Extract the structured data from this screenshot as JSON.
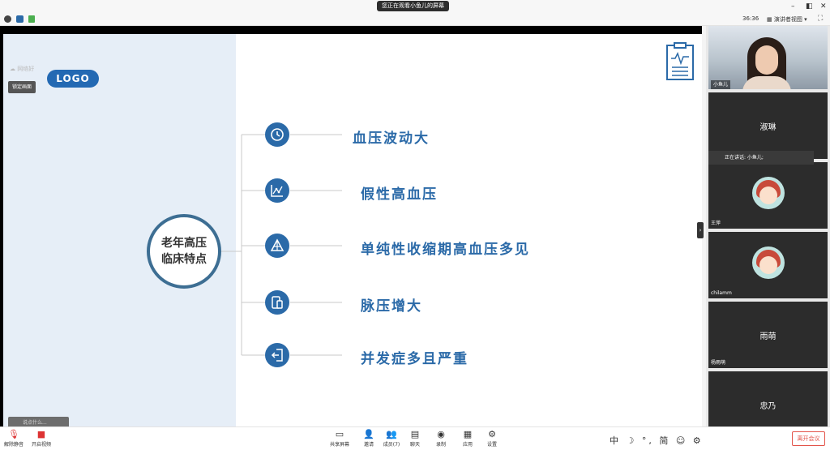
{
  "titlebar": {
    "viewing_label": "您正在观看小鱼儿的屏幕",
    "minimize": "–",
    "restore": "◧",
    "close": "✕"
  },
  "toolbar": {
    "timer": "36:36",
    "view_label": "▦ 演讲者视图 ▾",
    "fullscreen": "⛶"
  },
  "slide": {
    "logo": "LOGO",
    "center_title_line1": "老年高压",
    "center_title_line2": "临床特点",
    "items": [
      {
        "text": "血压波动大",
        "icon": "clock-icon"
      },
      {
        "text": "假性高血压",
        "icon": "chart-icon"
      },
      {
        "text": "单纯性收缩期高血压多见",
        "icon": "triangle-icon"
      },
      {
        "text": "脉压增大",
        "icon": "device-icon"
      },
      {
        "text": "并发症多且严重",
        "icon": "exit-icon"
      }
    ]
  },
  "overlay": {
    "top_hint": "☁ 网络好",
    "pin_label": "锁定画面",
    "chat_placeholder": "说点什么..."
  },
  "participants": {
    "self_name": "小鱼儿",
    "tile2_name": "淑琳",
    "speaking": "正在讲话: 小鱼儿;",
    "tile3_tag": "王萍",
    "tile4_tag": "chilamm",
    "tile5_name": "雨萌",
    "tile5_tag": "杨雨萌",
    "tile6_name": "忠乃"
  },
  "bottombar": {
    "mute": "解除静音",
    "video": "开启视频",
    "share": "共享屏幕",
    "invite": "邀请",
    "members": "成员(7)",
    "chat": "聊天",
    "record": "录制",
    "apps": "应用",
    "settings": "设置",
    "ime": "中 ☽ °, 简 ☺ ⚙",
    "leave": "离开会议"
  },
  "colors": {
    "accent": "#2b6aa8",
    "leave": "#e3544a"
  }
}
